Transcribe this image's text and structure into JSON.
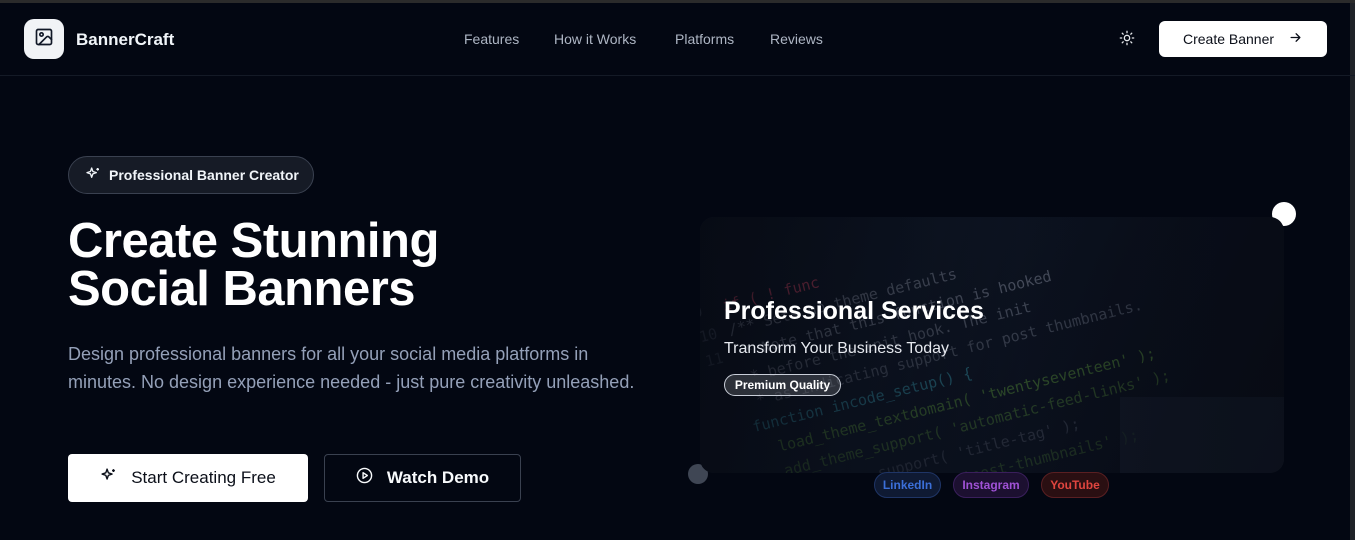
{
  "brand": {
    "name": "BannerCraft"
  },
  "nav": {
    "links": [
      "Features",
      "How it Works",
      "Platforms",
      "Reviews"
    ],
    "cta_label": "Create Banner"
  },
  "hero": {
    "badge": "Professional Banner Creator",
    "headline_line1": "Create Stunning",
    "headline_line2": "Social Banners",
    "subtext": "Design professional banners for all your social media platforms in minutes. No design experience needed - just pure creativity unleashed.",
    "primary_button": "Start Creating Free",
    "secondary_button": "Watch Demo"
  },
  "preview": {
    "title": "Professional Services",
    "subtitle": "Transform Your Business Today",
    "badge": "Premium Quality",
    "platforms": [
      "LinkedIn",
      "Instagram",
      "YouTube"
    ]
  },
  "colors": {
    "background": "#030712",
    "linkedin": "#3b6fd8",
    "instagram": "#a052d6",
    "youtube": "#e0453f"
  },
  "icons": {
    "logo": "image-icon",
    "theme": "sun-icon",
    "arrow": "arrow-right-icon",
    "sparkle": "sparkles-icon",
    "play": "play-circle-icon"
  }
}
